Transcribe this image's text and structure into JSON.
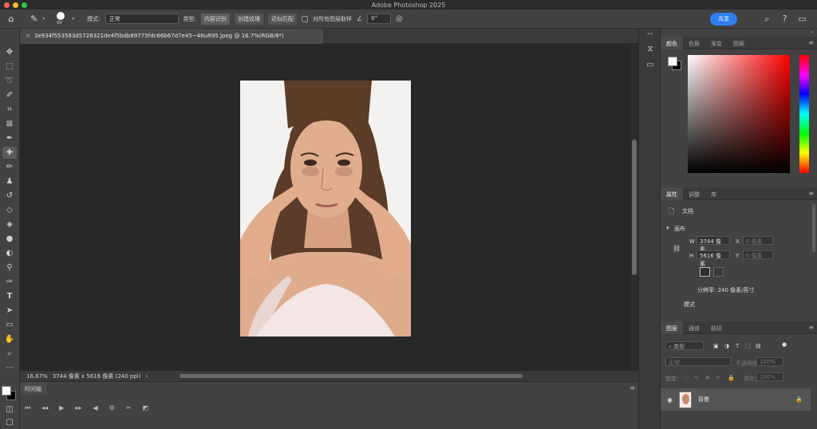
{
  "window": {
    "title": "Adobe Photoshop 2025"
  },
  "options_bar": {
    "brush_size": "69",
    "mode_label": "模式:",
    "mode_value": "正常",
    "type_label": "类型:",
    "type_buttons": [
      "内容识别",
      "创建纹理",
      "近似匹配"
    ],
    "sample_all_label": "对所有图层取样",
    "angle_value": "0°",
    "share_label": "共享"
  },
  "document": {
    "tab_title": "3e934f553583d5728321de4f5bdb89775fdc66b67d7e45~46uR95.jpeg @ 16.7%(RGB/8*)",
    "zoom": "16.67%",
    "info": "3744 像素 x 5616 像素 (240 ppi)"
  },
  "timeline": {
    "title": "时间轴"
  },
  "color_panel": {
    "tabs": [
      "颜色",
      "色板",
      "渐变",
      "图案"
    ],
    "foreground": "#ffffff",
    "background": "#000000"
  },
  "properties_panel": {
    "tabs": [
      "属性",
      "调整",
      "库"
    ],
    "doc_label": "文档",
    "canvas_section": "画布",
    "w_label": "W",
    "w_value": "3744 像素",
    "h_label": "H",
    "h_value": "5616 像素",
    "x_label": "X",
    "x_placeholder": "0 像素",
    "y_label": "Y",
    "y_placeholder": "0 像素",
    "resolution": "分辨率: 240 像素/英寸",
    "mode_label": "模式"
  },
  "layers_panel": {
    "tabs": [
      "图层",
      "通道",
      "路径"
    ],
    "filter_label": "类型",
    "blend_mode": "正常",
    "opacity_label": "不透明度:",
    "opacity_value": "100%",
    "lock_label": "锁定:",
    "fill_label": "填充:",
    "fill_value": "100%",
    "layers": [
      {
        "name": "背景"
      }
    ]
  },
  "colors": {
    "accent": "#2f7ff0",
    "canvas_bg": "#282828"
  }
}
